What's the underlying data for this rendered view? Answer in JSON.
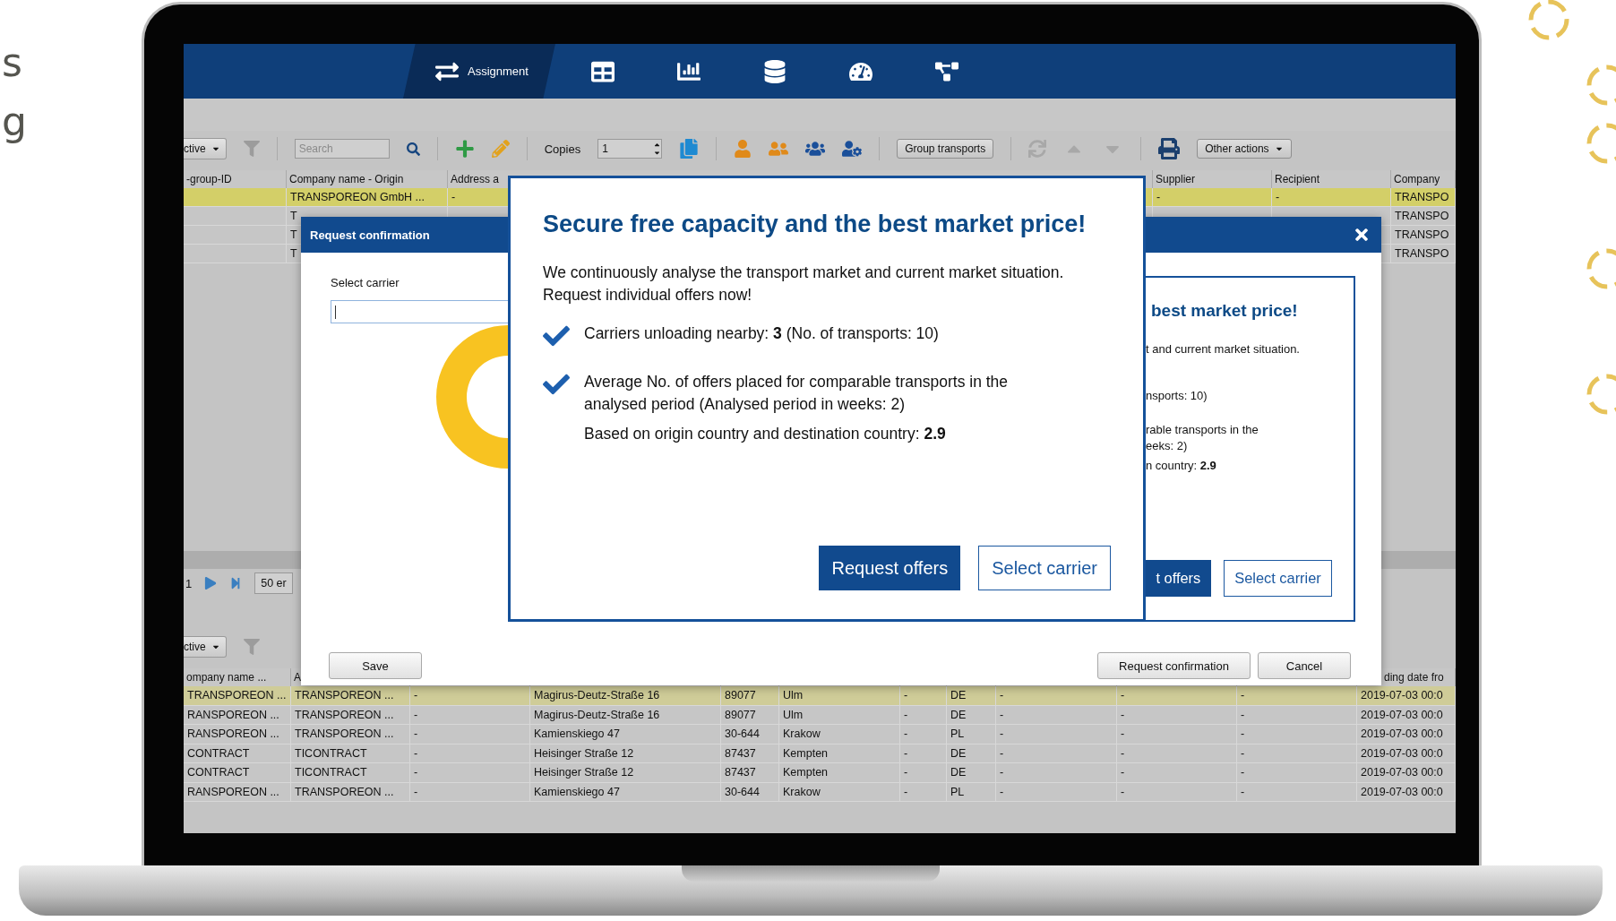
{
  "side_text": [
    "s",
    "g"
  ],
  "nav": {
    "tabs": [
      {
        "kind": "assignment",
        "label": "Assignment",
        "selected": true
      },
      {
        "kind": "calendar",
        "selected": false
      },
      {
        "kind": "chart",
        "selected": false
      },
      {
        "kind": "database",
        "selected": false
      },
      {
        "kind": "gauge",
        "selected": false
      },
      {
        "kind": "network",
        "selected": false
      }
    ]
  },
  "toolbar": {
    "status_filter": "ctive",
    "search_placeholder": "Search",
    "copies_label": "Copies",
    "copies_value": "1",
    "group_button": "Group transports",
    "other_actions": "Other actions"
  },
  "top_table": {
    "columns": [
      "-group-ID",
      "Company name - Origin",
      "Address a",
      "Supplier",
      "Recipient",
      "Company"
    ],
    "rows": [
      {
        "selected": true,
        "cells": [
          null,
          "TRANSPOREON GmbH ...",
          "-",
          "-",
          "-",
          "TRANSPO"
        ]
      },
      {
        "selected": false,
        "cells": [
          null,
          "T",
          null,
          null,
          null,
          "TRANSPO"
        ]
      },
      {
        "selected": false,
        "cells": [
          null,
          "T",
          null,
          null,
          null,
          "TRANSPO"
        ]
      },
      {
        "selected": false,
        "cells": [
          null,
          "T",
          null,
          null,
          null,
          "TRANSPO"
        ]
      }
    ]
  },
  "pagination": {
    "page": "1",
    "page_size": "50 er"
  },
  "bottom_toolbar": {
    "status_filter": "ctive"
  },
  "bottom_table": {
    "columns": [
      "ompany name ...",
      "A",
      null,
      null,
      null,
      null,
      null,
      null,
      null,
      null,
      null,
      "ding date fro"
    ],
    "rows": [
      {
        "selected": true,
        "cells": [
          "TRANSPOREON ...",
          "TRANSPOREON ...",
          "-",
          "Magirus-Deutz-Straße 16",
          "89077",
          "Ulm",
          "-",
          "DE",
          "-",
          "-",
          "-",
          "2019-07-03 00:0"
        ]
      },
      {
        "selected": false,
        "cells": [
          "RANSPOREON ...",
          "TRANSPOREON ...",
          "-",
          "Magirus-Deutz-Straße 16",
          "89077",
          "Ulm",
          "-",
          "DE",
          "-",
          "-",
          "-",
          "2019-07-03 00:0"
        ]
      },
      {
        "selected": false,
        "cells": [
          "RANSPOREON ...",
          "TRANSPOREON ...",
          "-",
          "Kamienskiego 47",
          "30-644",
          "Krakow",
          "-",
          "PL",
          "-",
          "-",
          "-",
          "2019-07-03 00:0"
        ]
      },
      {
        "selected": false,
        "cells": [
          "CONTRACT",
          "TICONTRACT",
          "-",
          "Heisinger Straße 12",
          "87437",
          "Kempten",
          "-",
          "DE",
          "-",
          "-",
          "-",
          "2019-07-03 00:0"
        ]
      },
      {
        "selected": false,
        "cells": [
          "CONTRACT",
          "TICONTRACT",
          "-",
          "Heisinger Straße 12",
          "87437",
          "Kempten",
          "-",
          "DE",
          "-",
          "-",
          "-",
          "2019-07-03 00:0"
        ]
      },
      {
        "selected": false,
        "cells": [
          "RANSPOREON ...",
          "TRANSPOREON ...",
          "-",
          "Kamienskiego 47",
          "30-644",
          "Krakow",
          "-",
          "PL",
          "-",
          "-",
          "-",
          "2019-07-03 00:0"
        ]
      }
    ]
  },
  "request_dialog": {
    "title": "Request confirmation",
    "field_label": "Select carrier",
    "buttons": {
      "save": "Save",
      "confirm": "Request confirmation",
      "cancel": "Cancel"
    }
  },
  "promo_behind": {
    "title": "best market price!",
    "lines": [
      "t and current market situation.",
      "nsports: 10)",
      "rable transports in the",
      "eeks: 2)",
      "n country: **2.9**"
    ],
    "primary": "t offers",
    "secondary": "Select carrier"
  },
  "promo": {
    "title": "Secure free capacity and the best market price!",
    "intro": [
      "We continuously analyse the transport market and current market situation.",
      "Request individual offers now!"
    ],
    "items": [
      {
        "text": "Carriers unloading nearby: **3** (No. of transports: 10)"
      },
      {
        "text": "Average No. of offers placed for comparable transports in the analysed period (Analysed period in weeks: 2)",
        "note": "Based on origin country and destination country: **2.9**"
      }
    ],
    "primary": "Request offers",
    "secondary": "Select carrier"
  }
}
